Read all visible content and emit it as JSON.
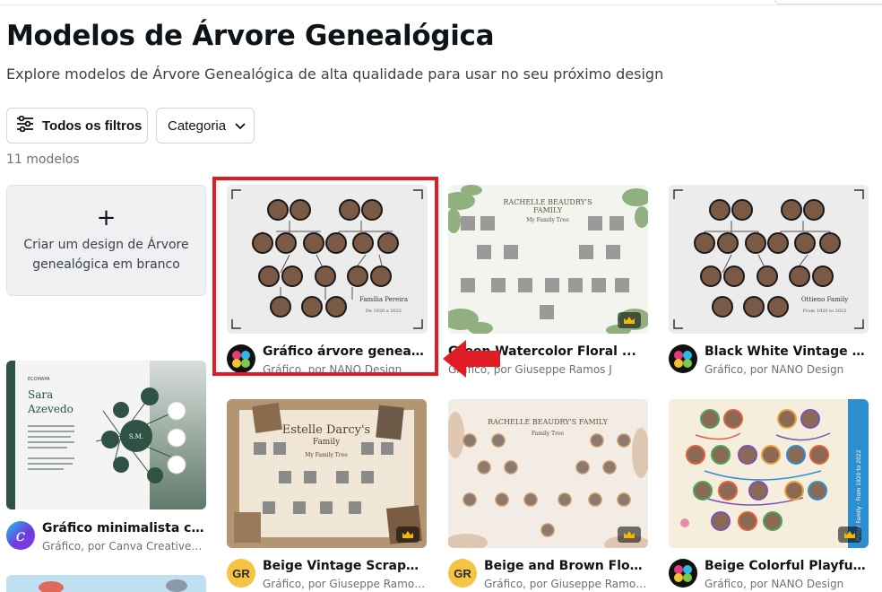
{
  "page": {
    "title": "Modelos de Árvore Genealógica",
    "subtitle": "Explore modelos de Árvore Genealógica de alta qualidade para usar no seu próximo design"
  },
  "filters": {
    "all_filters_label": "Todos os filtros",
    "category_label": "Categoria"
  },
  "results": {
    "count_label": "11 modelos"
  },
  "blank_card": {
    "plus": "+",
    "label": "Criar um design de Árvore genealógica em branco"
  },
  "templates": [
    {
      "title": "Gráfico árvore genealógi...",
      "subtitle": "Gráfico, por NANO Design",
      "author_badge": "nano",
      "premium": false,
      "preview_text": [
        "Família Pereira",
        "De 1920 a 2022"
      ]
    },
    {
      "title": "Green Watercolor Floral ...",
      "subtitle": "Gráfico, por Giuseppe Ramos J",
      "author_badge": "none",
      "premium": true,
      "preview_text": [
        "RACHELLE BEAUDRY'S",
        "FAMILY",
        "My Family Tree"
      ]
    },
    {
      "title": "Black White Vintage Fami...",
      "subtitle": "Gráfico, por NANO Design",
      "author_badge": "nano",
      "premium": false,
      "preview_text": [
        "Ottieno Family",
        "From 1920 to 2022"
      ]
    },
    {
      "title": "Gráfico minimalista cláss...",
      "subtitle": "Gráfico, por Canva Creative St...",
      "author_badge": "canva",
      "premium": false,
      "preview_text": [
        "ECOMAPA",
        "Sara",
        "Azevedo",
        "S.M."
      ]
    },
    {
      "title": "Beige Vintage Scrapbook ...",
      "subtitle": "Gráfico, por Giuseppe Ramos J",
      "author_badge": "GR",
      "premium": true,
      "preview_text": [
        "Estelle Darcy's",
        "Family",
        "My Family Tree"
      ]
    },
    {
      "title": "Beige and Brown Floral V...",
      "subtitle": "Gráfico, por Giuseppe Ramos J",
      "author_badge": "GR",
      "premium": true,
      "preview_text": [
        "RACHELLE BEAUDRY'S FAMILY",
        "Family Tree"
      ]
    },
    {
      "title": "Beige Colorful Playful Fa...",
      "subtitle": "Gráfico, por NANO Design",
      "author_badge": "nano",
      "premium": true,
      "preview_text": [
        "Pinter Family · From 1920 to 2022"
      ]
    }
  ],
  "colors": {
    "highlight": "#e01b24",
    "badge_gr": "#f6c443",
    "text_primary": "#0e1318",
    "text_secondary": "#6b7079"
  },
  "icons": {
    "filters": "sliders-icon",
    "category": "chevron-down-icon",
    "premium": "crown-icon",
    "pointer": "red-arrow-icon"
  }
}
